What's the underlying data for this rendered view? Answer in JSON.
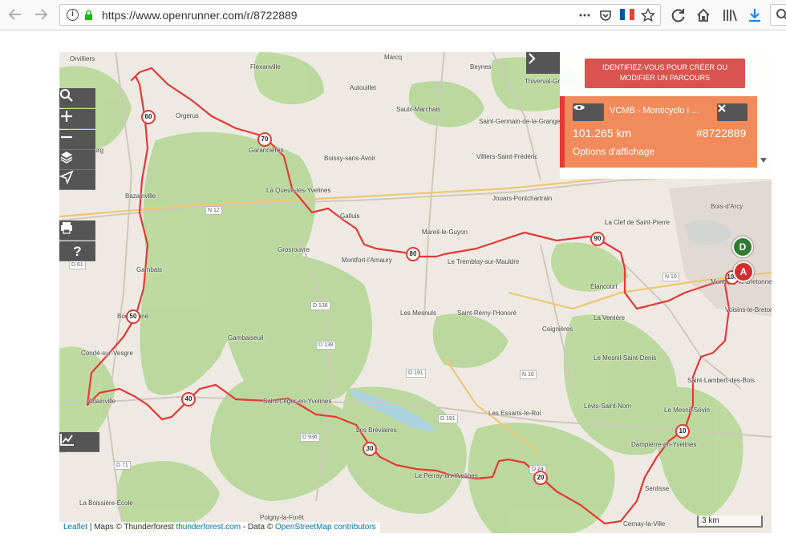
{
  "browser": {
    "url": "https://www.openrunner.com/r/8722889",
    "back_icon": "arrow-left-icon",
    "forward_icon": "arrow-right-icon"
  },
  "panel": {
    "login_button": "IDENTIFIEZ-VOUS POUR CRÉER OU MODIFIER UN PARCOURS",
    "track_name": "VCMB - Monticyclo i ...",
    "distance": "101.265 km",
    "track_id": "#8722889",
    "options_label": "Options d'affichage"
  },
  "markers": {
    "start": "D",
    "finish": "A",
    "km": [
      "10",
      "20",
      "30",
      "40",
      "50",
      "60",
      "70",
      "80",
      "90",
      "100"
    ]
  },
  "places": [
    "Orvilliers",
    "Flexanville",
    "Marcq",
    "Beynes",
    "Thiverval-Grignon",
    "Orgerus",
    "Autouillet",
    "Saulx-Marchais",
    "Saint-Germain-de-la-Grange",
    "Richebourg",
    "Garancières",
    "Boissy-sans-Avoir",
    "Villiers-Saint-Frédéric",
    "Bazainville",
    "La Queue-les-Yvelines",
    "Jouars-Pontchartrain",
    "Bois-d'Arcy",
    "Galluis",
    "La Clef de Saint-Pierre",
    "Mareil-le-Guyon",
    "Fontenay-le-Fleury",
    "Grosrouvre",
    "Montfort-l'Amaury",
    "Le Tremblay-sur-Mauldre",
    "Élancourt",
    "Gambais",
    "Montigny-le-Bretonneux",
    "Bourdonné",
    "Les Mesnuls",
    "Saint-Rémy-l'Honoré",
    "La Verrière",
    "Voisins-le-Bretonneux",
    "Gambaiseuil",
    "Coignières",
    "Condé-sur-Vesgre",
    "Le Mesnil-Saint-Denis",
    "Saint-Lambert-des-Bois",
    "Adainville",
    "Saint-Léger-en-Yvelines",
    "Lévis-Saint-Nom",
    "Le Mesnil-Sévin",
    "Les Essarts-le-Roi",
    "Les Bréviaires",
    "Dampierre-en-Yvelines",
    "Le Perray-en-Yvelines",
    "Senlisse",
    "La Boissière-École",
    "Poigny-la-Forêt",
    "Cernay-la-Ville",
    "Vieille-Église-en-Yvelines"
  ],
  "roads": [
    "N 12",
    "D 61",
    "D 138",
    "D 138",
    "D 191",
    "N 10",
    "N 10",
    "D 191",
    "D 936",
    "D 71",
    "D 24"
  ],
  "attribution": {
    "leaflet": "Leaflet",
    "maps": "| Maps © Thunderforest",
    "tf_link": "thunderforest.com",
    "data": "- Data ©",
    "osm_link": "OpenStreetMap contributors"
  },
  "scale": "3 km",
  "colors": {
    "route": "#e53935",
    "login_button": "#d9534f",
    "track_card": "#f28b5b",
    "forest": "#b9d99b",
    "start_pin": "#2e7d32",
    "finish_pin": "#d32f2f"
  }
}
